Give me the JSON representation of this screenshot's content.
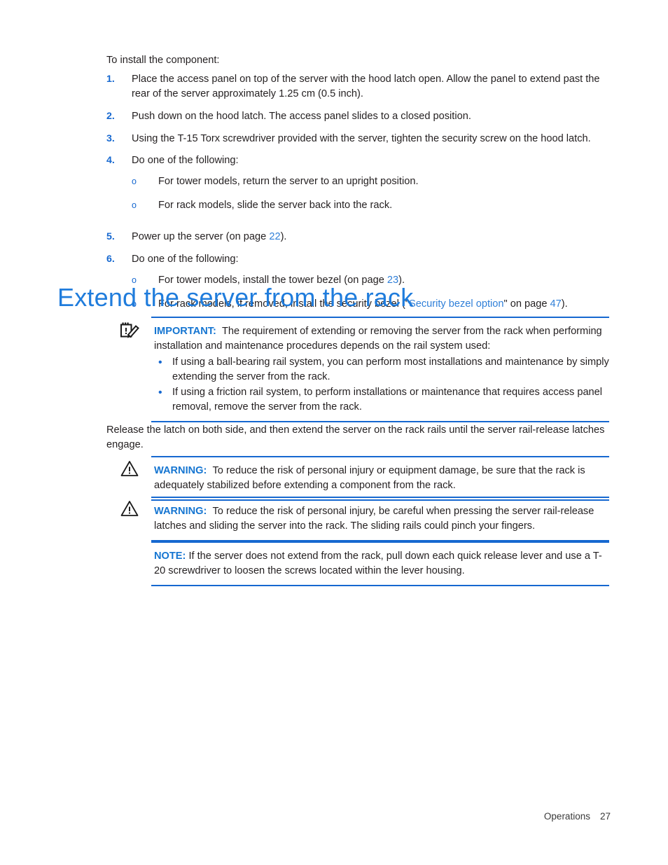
{
  "intro": "To install the component:",
  "steps": [
    {
      "num": "1.",
      "text": "Place the access panel on top of the server with the hood latch open. Allow the panel to extend past the rear of the server approximately 1.25 cm (0.5 inch)."
    },
    {
      "num": "2.",
      "text": "Push down on the hood latch. The access panel slides to a closed position."
    },
    {
      "num": "3.",
      "text": "Using the T-15 Torx screwdriver provided with the server, tighten the security screw on the hood latch."
    },
    {
      "num": "4.",
      "text": "Do one of the following:",
      "subs": [
        {
          "marker": "o",
          "text": "For tower models, return the server to an upright position."
        },
        {
          "marker": "o",
          "text": "For rack models, slide the server back into the rack."
        }
      ]
    },
    {
      "num": "5.",
      "text_before": "Power up the server (on page ",
      "link": "22",
      "text_after": ")."
    },
    {
      "num": "6.",
      "text": "Do one of the following:",
      "subs": [
        {
          "marker": "o",
          "text_before": "For tower models, install the tower bezel (on page ",
          "link": "23",
          "text_after": ")."
        },
        {
          "marker": "o",
          "text_before": "For rack models, if removed, install the security bezel (\"",
          "link": "Security bezel option",
          "text_mid": "\" on page ",
          "link2": "47",
          "text_after": ")."
        }
      ]
    }
  ],
  "heading": "Extend the server from the rack",
  "important": {
    "icon": "note-pencil-icon",
    "label": "IMPORTANT:",
    "text": "The requirement of extending or removing the server from the rack when performing installation and maintenance procedures depends on the rail system used:",
    "bullets": [
      "If using a ball-bearing rail system, you can perform most installations and maintenance by simply extending the server from the rack.",
      "If using a friction rail system, to perform installations or maintenance that requires access panel removal, remove the server from the rack."
    ]
  },
  "release_paragraph": "Release the latch on both side, and then extend the server on the rack rails until the server rail-release latches engage.",
  "warning1": {
    "icon": "warning-triangle-icon",
    "label": "WARNING:",
    "text": "To reduce the risk of personal injury or equipment damage, be sure that the rack is adequately stabilized before extending a component from the rack."
  },
  "warning2": {
    "icon": "warning-triangle-icon",
    "label": "WARNING:",
    "text": "To reduce the risk of personal injury, be careful when pressing the server rail-release latches and sliding the server into the rack. The sliding rails could pinch your fingers."
  },
  "note": {
    "label": "NOTE:",
    "text": "If the server does not extend from the rack, pull down each quick release lever and use a T-20 screwdriver to loosen the screws located within the lever housing."
  },
  "footer": {
    "section": "Operations",
    "page": "27"
  },
  "colors": {
    "link": "#2f7fd8",
    "heading": "#1f7cdc",
    "rule": "#1668d0",
    "label": "#1575d1",
    "body": "#231f20"
  }
}
